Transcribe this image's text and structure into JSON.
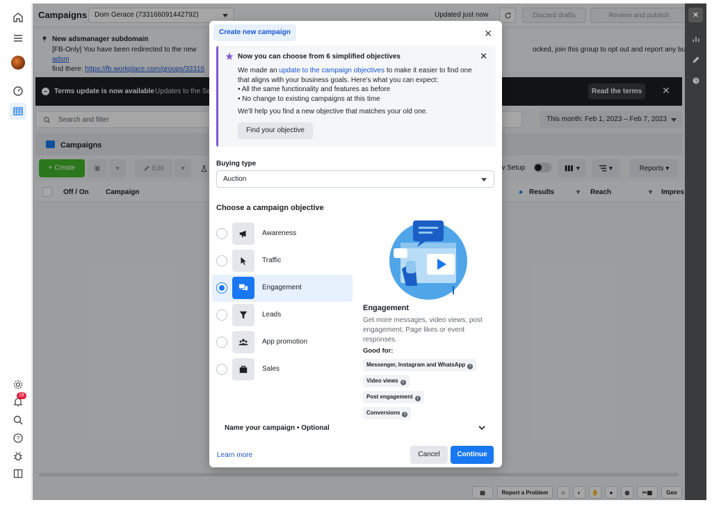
{
  "topbar": {
    "title": "Campaigns",
    "account": "Dom Gerace (733166091442792)",
    "updated": "Updated just now",
    "discard": "Discard drafts",
    "review": "Review and publish",
    "more": "..."
  },
  "notice": {
    "title": "New adsmanager subdomain",
    "line1": "[FB-Only] You have been redirected to the new ",
    "line1_link": "adsm",
    "line2": "find there: ",
    "line2_link": "https://fb.workplace.com/groups/33316",
    "right": "ocked, join this group to opt out and report any bugs you"
  },
  "terms": {
    "title": "Terms update is now available",
    "sub": "Updates to the Se",
    "read": "Read the terms"
  },
  "search": {
    "placeholder": "Search and filter"
  },
  "daterange": "This month: Feb 1, 2023 – Feb 7, 2023",
  "tab": {
    "label": "Campaigns"
  },
  "toolbar": {
    "create": "+ Create",
    "edit": "Edit",
    "view_setup": "w Setup",
    "reports": "Reports"
  },
  "table": {
    "col_off_on": "Off / On",
    "col_campaign": "Campaign",
    "col_results": "Results",
    "col_reach": "Reach",
    "col_impr": "Impres"
  },
  "bottombar": {
    "report": "Report a Problem",
    "geo": "Geo"
  },
  "leftnav": {
    "badge": "18"
  },
  "modal": {
    "tab_label": "Create new campaign",
    "info_title": "Now you can choose from 6 simplified objectives",
    "info_text_pre": "We made an ",
    "info_link": "update to the campaign objectives",
    "info_text_post": " to make it easier to find one that aligns with your business goals. Here's what you can expect:",
    "bullet1": "All the same functionality and features as before",
    "bullet2": "No change to existing campaigns at this time",
    "info_footer": "We'll help you find a new objective that matches your old one.",
    "find_btn": "Find your objective",
    "buying_type_label": "Buying type",
    "buying_type_value": "Auction",
    "objective_label": "Choose a campaign objective",
    "objectives": [
      {
        "label": "Awareness"
      },
      {
        "label": "Traffic"
      },
      {
        "label": "Engagement"
      },
      {
        "label": "Leads"
      },
      {
        "label": "App promotion"
      },
      {
        "label": "Sales"
      }
    ],
    "selected_objective": "Engagement",
    "detail_title": "Engagement",
    "detail_desc": "Get more messages, video views, post engagement, Page likes or event responses.",
    "good_for_label": "Good for:",
    "tags": [
      "Messenger, Instagram and WhatsApp",
      "Video views",
      "Post engagement",
      "Conversions"
    ],
    "name_campaign": "Name your campaign • Optional",
    "learn_more": "Learn more",
    "cancel": "Cancel",
    "continue": "Continue"
  },
  "colors": {
    "primary": "#1877f2",
    "create_green": "#42b72a",
    "info_accent": "#7e55d6"
  }
}
